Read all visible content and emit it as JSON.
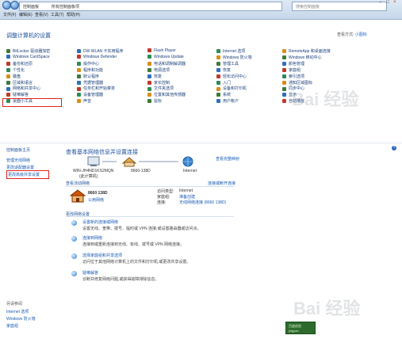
{
  "window": {
    "address": [
      "控制面板",
      "所有控制面板项"
    ],
    "search_placeholder": "搜索控制面板",
    "menu": [
      "文件(F)",
      "编辑(E)",
      "查看(V)",
      "工具(T)",
      "帮助(H)"
    ]
  },
  "control_panel": {
    "title": "调整计算机的设置",
    "view_by_label": "查看方式:",
    "view_by_value": "小图标",
    "columns": [
      [
        "BitLocker 驱动器加密",
        "Windows CardSpace",
        "备份和还原",
        "个性化",
        "键盘",
        "区域和语言",
        "网络和共享中心",
        "疑难解答",
        "桌面小工具"
      ],
      [
        "DW WLAN 卡实用程序",
        "Windows Defender",
        "操作中心",
        "程序和功能",
        "默认程序",
        "凭据管理器",
        "任务栏和开始菜单",
        "设备管理器",
        "声音"
      ],
      [
        "Flash Player",
        "Windows Update",
        "电话和调制解调器",
        "电源选项",
        "恢复",
        "家长控制",
        "文件夹选项",
        "位置和其他传感器",
        "鼠标"
      ],
      [
        "Internet 选项",
        "Windows 防火墙",
        "管理工具",
        "恢复",
        "轻松访问中心",
        "入门",
        "设备和打印机",
        "系统",
        "用户帐户"
      ],
      [
        "RemoteApp 和桌面连接",
        "Windows 移动中心",
        "颜色管理",
        "家庭组",
        "索引选项",
        "通知区域图标",
        "同步中心",
        "显示",
        "自动播放"
      ]
    ],
    "icon_colors": [
      "#3d7a3d",
      "#2f6fbf",
      "#c0392b",
      "#2e8b57",
      "#d98e1a"
    ]
  },
  "network_center": {
    "sidebar_title": "控制面板主页",
    "sidebar_links": [
      "管理无线网络",
      "更改适配器设置",
      "更改高级共享设置"
    ],
    "title": "查看基本网络信息并设置连接",
    "see_full_map": "查看完整映射",
    "nodes": [
      {
        "label": "WIN-JH4ND1KS2MQN",
        "sub": "(此计算机)"
      },
      {
        "label": "8660-138D",
        "sub": ""
      },
      {
        "label": "Internet",
        "sub": ""
      }
    ],
    "active_section": "查看活动网络",
    "connect_disconnect": "连接或断开连接",
    "network_name": "8660 138D",
    "network_type": "公用网络",
    "access_type_label": "访问类型:",
    "access_type_value": "Internet",
    "homegroup_label": "家庭组:",
    "homegroup_value": "准备创建",
    "connections_label": "连接:",
    "connections_value": "无线网络连接 (8660 138D)",
    "change_section": "更改网络设置",
    "tasks": [
      {
        "title": "设置新的连接或网络",
        "desc": "设置无线、宽带、拨号、临时或 VPN 连接;或设置路由器或访问点。"
      },
      {
        "title": "连接到网络",
        "desc": "连接到或重新连接到无线、有线、拨号或 VPN 网络连接。"
      },
      {
        "title": "选择家庭组和共享选项",
        "desc": "访问位于其他网络计算机上的文件和打印机,或更改共享设置。"
      },
      {
        "title": "疑难解答",
        "desc": "诊断并修复网络问题,或获得故障排除信息。"
      }
    ],
    "see_also_title": "另请参阅",
    "see_also": [
      "Internet 选项",
      "Windows 防火墙",
      "家庭组"
    ],
    "help": "?"
  },
  "watermark": "Bai 经验",
  "stamp": [
    "百度经验",
    "jingyan"
  ]
}
